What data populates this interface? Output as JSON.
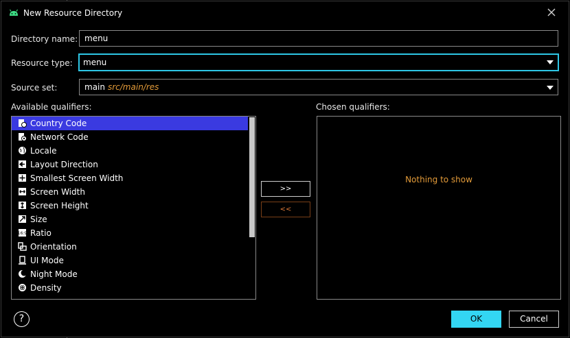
{
  "dialog": {
    "title": "New Resource Directory",
    "directory_name": {
      "label": "Directory name:",
      "value": "menu"
    },
    "resource_type": {
      "label": "Resource type:",
      "value": "menu"
    },
    "source_set": {
      "label": "Source set:",
      "value": "main",
      "path": "src/main/res"
    },
    "available": {
      "label": "Available qualifiers:",
      "items": [
        {
          "label": "Country Code",
          "icon": "country-code-icon",
          "selected": true
        },
        {
          "label": "Network Code",
          "icon": "network-code-icon"
        },
        {
          "label": "Locale",
          "icon": "globe-icon"
        },
        {
          "label": "Layout Direction",
          "icon": "layout-direction-icon"
        },
        {
          "label": "Smallest Screen Width",
          "icon": "smallest-width-icon"
        },
        {
          "label": "Screen Width",
          "icon": "screen-width-icon"
        },
        {
          "label": "Screen Height",
          "icon": "screen-height-icon"
        },
        {
          "label": "Size",
          "icon": "size-icon"
        },
        {
          "label": "Ratio",
          "icon": "ratio-icon"
        },
        {
          "label": "Orientation",
          "icon": "orientation-icon"
        },
        {
          "label": "UI Mode",
          "icon": "ui-mode-icon"
        },
        {
          "label": "Night Mode",
          "icon": "night-mode-icon"
        },
        {
          "label": "Density",
          "icon": "density-icon"
        }
      ]
    },
    "chosen": {
      "label": "Chosen qualifiers:",
      "empty_text": "Nothing to show"
    },
    "move_right_label": ">>",
    "move_left_label": "<<",
    "help_label": "?",
    "ok_label": "OK",
    "cancel_label": "Cancel"
  },
  "colors": {
    "accent": "#2ec7e6",
    "selection": "#3a3ae0",
    "warning_text": "#e39b39",
    "android_green": "#3ddc84"
  }
}
